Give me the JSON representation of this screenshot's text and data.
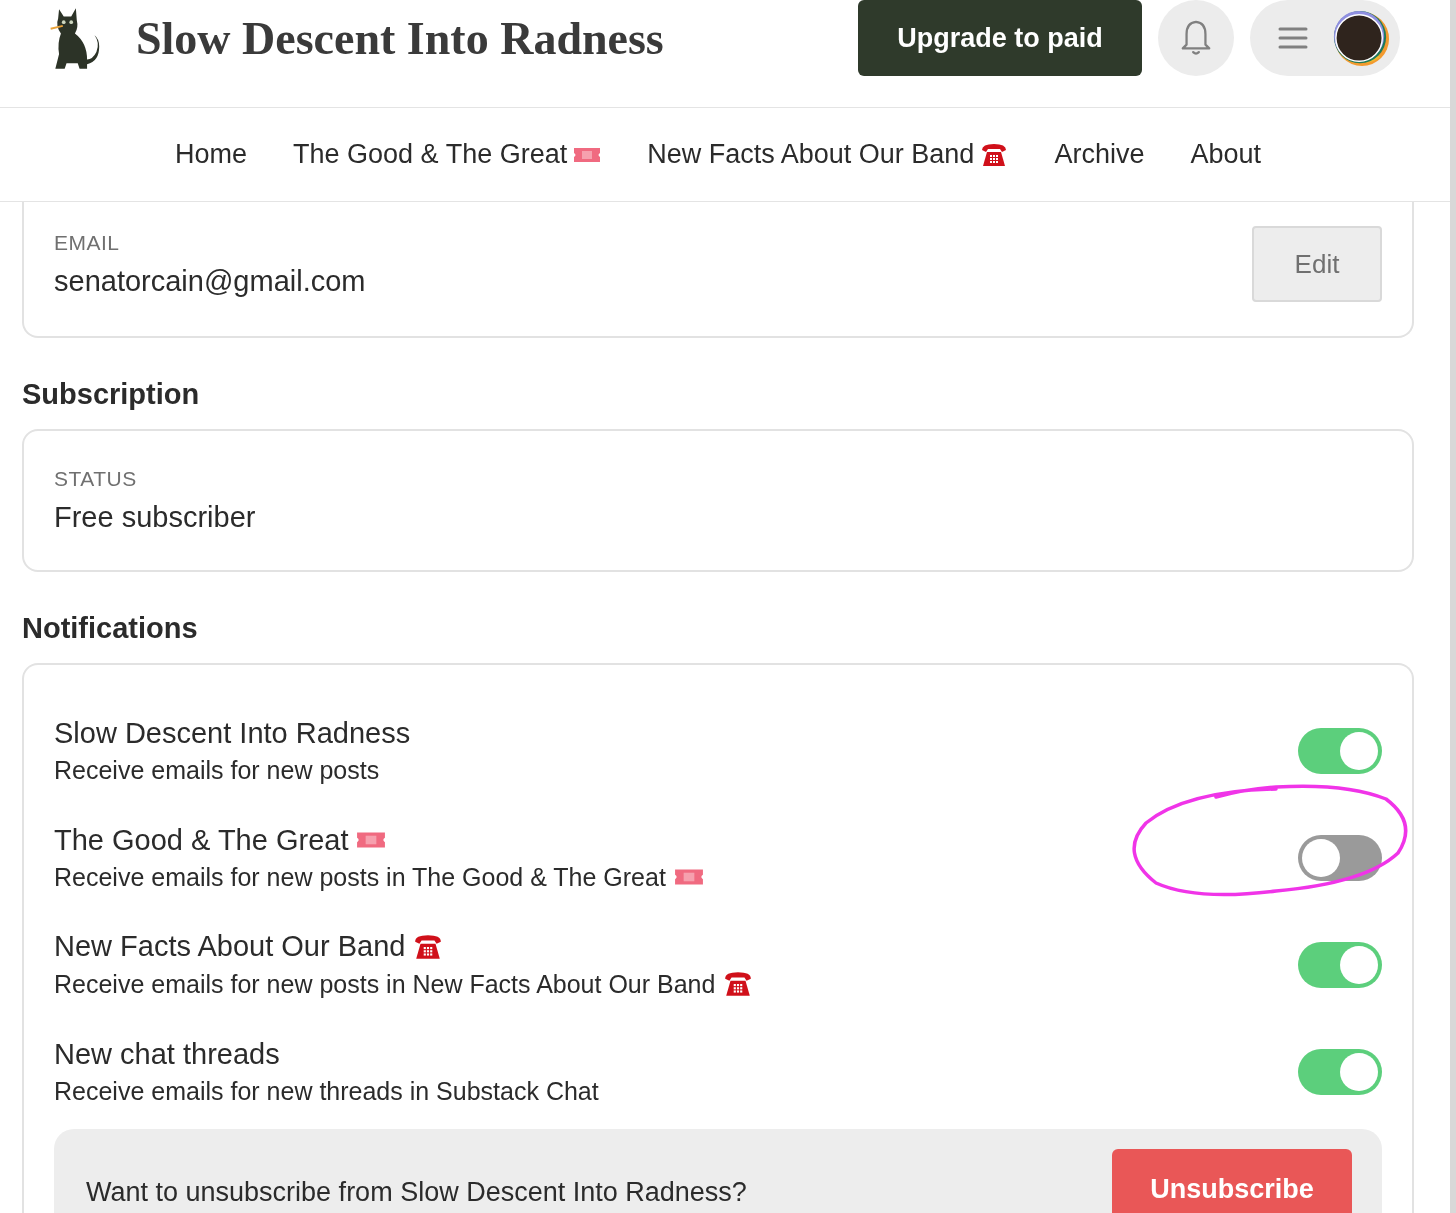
{
  "header": {
    "title": "Slow Descent Into Radness",
    "upgrade_button": "Upgrade to paid"
  },
  "nav": [
    {
      "label": "Home",
      "kind": "plain"
    },
    {
      "label": "The Good & The Great",
      "kind": "ticket"
    },
    {
      "label": "New Facts About Our Band",
      "kind": "phone"
    },
    {
      "label": "Archive",
      "kind": "plain"
    },
    {
      "label": "About",
      "kind": "plain"
    }
  ],
  "email": {
    "label": "EMAIL",
    "value": "senatorcain@gmail.com",
    "button": "Edit"
  },
  "subscription": {
    "heading": "Subscription",
    "label": "STATUS",
    "value": "Free subscriber"
  },
  "notifications": {
    "heading": "Notifications",
    "items": [
      {
        "title": "Slow Descent Into Radness",
        "subtitle": "Receive emails for new posts",
        "kind": "plain",
        "on": true,
        "circled": false
      },
      {
        "title": "The Good & The Great",
        "subtitle": "Receive emails for new posts in The Good & The Great",
        "kind": "ticket",
        "on": false,
        "circled": true
      },
      {
        "title": "New Facts About Our Band",
        "subtitle": "Receive emails for new posts in New Facts About Our Band",
        "kind": "phone",
        "on": true,
        "circled": false
      },
      {
        "title": "New chat threads",
        "subtitle": "Receive emails for new threads in Substack Chat",
        "kind": "plain",
        "on": true,
        "circled": false
      }
    ]
  },
  "unsubscribe": {
    "question": "Want to unsubscribe from Slow Descent Into Radness?",
    "button": "Unsubscribe"
  }
}
